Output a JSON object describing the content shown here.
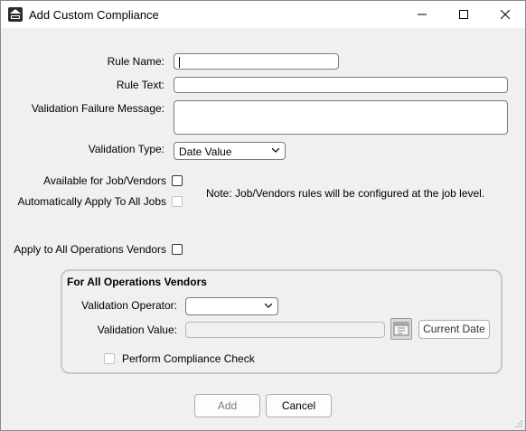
{
  "window": {
    "title": "Add Custom Compliance",
    "app_icon": "sfc-logo-icon"
  },
  "titlebar_buttons": {
    "minimize": "minimize-icon",
    "maximize": "maximize-icon",
    "close": "close-icon"
  },
  "form": {
    "rule_name_label": "Rule Name:",
    "rule_name_value": "",
    "rule_text_label": "Rule Text:",
    "rule_text_value": "",
    "failure_message_label": "Validation Failure Message:",
    "failure_message_value": "",
    "validation_type_label": "Validation Type:",
    "validation_type_value": "Date Value",
    "available_label": "Available for Job/Vendors",
    "available_checked": false,
    "auto_apply_label": "Automatically Apply To All Jobs",
    "auto_apply_checked": false,
    "note": "Note:  Job/Vendors rules will be configured at the job level.",
    "apply_all_ops_label": "Apply to All Operations Vendors",
    "apply_all_ops_checked": false
  },
  "group": {
    "title": "For All Operations Vendors",
    "operator_label": "Validation Operator:",
    "operator_value": "",
    "value_label": "Validation Value:",
    "value_value": "",
    "calendar_icon": "calendar-icon",
    "current_date_label": "Current Date",
    "perform_check_label": "Perform Compliance Check",
    "perform_check_checked": false
  },
  "buttons": {
    "add": "Add",
    "cancel": "Cancel"
  }
}
